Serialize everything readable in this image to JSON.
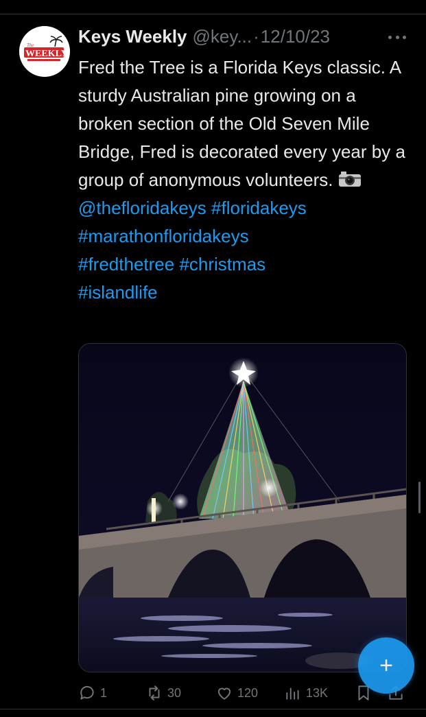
{
  "tweet": {
    "author": {
      "name": "Keys Weekly",
      "handle": "@key...",
      "separator": "·",
      "date": "12/10/23",
      "avatar_logo_text": "WEEKLY",
      "avatar_logo_small": "The"
    },
    "text_parts": {
      "body": "Fred the Tree is a Florida Keys classic. A sturdy Australian pine growing on a broken section of the Old Seven Mile Bridge, Fred is decorated every year by a group of anonymous volunteers.",
      "mention": "@thefloridakeys",
      "tag1": "#floridakeys",
      "tag2": "#marathonfloridakeys",
      "tag3": "#fredthetree",
      "tag4": "#christmas",
      "tag5": "#islandlife"
    },
    "media": {
      "description_icon": "photo-of-lit-tree-on-bridge"
    },
    "actions": {
      "replies": "1",
      "reposts": "30",
      "likes": "120",
      "views": "13K"
    }
  },
  "icons": {
    "more": "more-icon",
    "reply": "reply-icon",
    "repost": "repost-icon",
    "like": "like-icon",
    "views": "views-icon",
    "bookmark": "bookmark-icon",
    "share": "share-icon",
    "compose": "compose-icon",
    "camera": "camera-icon"
  },
  "fab": {
    "label": "+"
  },
  "colors": {
    "background": "#000000",
    "text": "#e7e9ea",
    "muted": "#71767b",
    "link": "#1d9bf0",
    "divider": "#2f3336"
  }
}
